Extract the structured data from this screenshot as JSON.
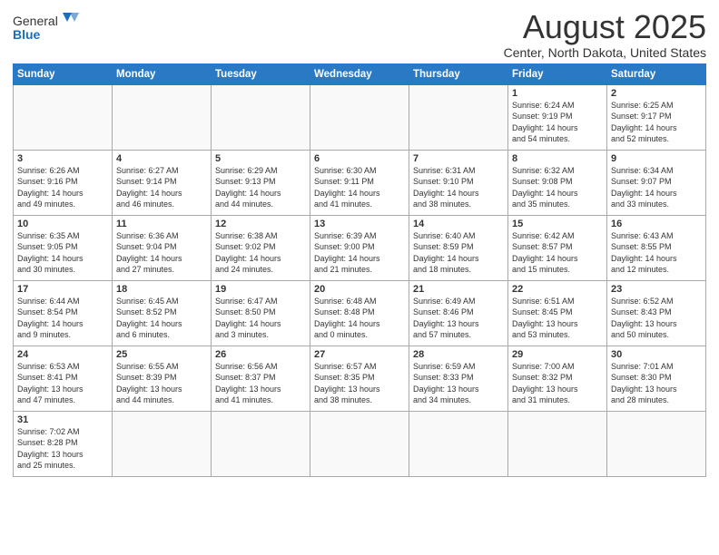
{
  "header": {
    "logo_general": "General",
    "logo_blue": "Blue",
    "title": "August 2025",
    "subtitle": "Center, North Dakota, United States"
  },
  "weekdays": [
    "Sunday",
    "Monday",
    "Tuesday",
    "Wednesday",
    "Thursday",
    "Friday",
    "Saturday"
  ],
  "weeks": [
    [
      {
        "day": "",
        "info": ""
      },
      {
        "day": "",
        "info": ""
      },
      {
        "day": "",
        "info": ""
      },
      {
        "day": "",
        "info": ""
      },
      {
        "day": "",
        "info": ""
      },
      {
        "day": "1",
        "info": "Sunrise: 6:24 AM\nSunset: 9:19 PM\nDaylight: 14 hours\nand 54 minutes."
      },
      {
        "day": "2",
        "info": "Sunrise: 6:25 AM\nSunset: 9:17 PM\nDaylight: 14 hours\nand 52 minutes."
      }
    ],
    [
      {
        "day": "3",
        "info": "Sunrise: 6:26 AM\nSunset: 9:16 PM\nDaylight: 14 hours\nand 49 minutes."
      },
      {
        "day": "4",
        "info": "Sunrise: 6:27 AM\nSunset: 9:14 PM\nDaylight: 14 hours\nand 46 minutes."
      },
      {
        "day": "5",
        "info": "Sunrise: 6:29 AM\nSunset: 9:13 PM\nDaylight: 14 hours\nand 44 minutes."
      },
      {
        "day": "6",
        "info": "Sunrise: 6:30 AM\nSunset: 9:11 PM\nDaylight: 14 hours\nand 41 minutes."
      },
      {
        "day": "7",
        "info": "Sunrise: 6:31 AM\nSunset: 9:10 PM\nDaylight: 14 hours\nand 38 minutes."
      },
      {
        "day": "8",
        "info": "Sunrise: 6:32 AM\nSunset: 9:08 PM\nDaylight: 14 hours\nand 35 minutes."
      },
      {
        "day": "9",
        "info": "Sunrise: 6:34 AM\nSunset: 9:07 PM\nDaylight: 14 hours\nand 33 minutes."
      }
    ],
    [
      {
        "day": "10",
        "info": "Sunrise: 6:35 AM\nSunset: 9:05 PM\nDaylight: 14 hours\nand 30 minutes."
      },
      {
        "day": "11",
        "info": "Sunrise: 6:36 AM\nSunset: 9:04 PM\nDaylight: 14 hours\nand 27 minutes."
      },
      {
        "day": "12",
        "info": "Sunrise: 6:38 AM\nSunset: 9:02 PM\nDaylight: 14 hours\nand 24 minutes."
      },
      {
        "day": "13",
        "info": "Sunrise: 6:39 AM\nSunset: 9:00 PM\nDaylight: 14 hours\nand 21 minutes."
      },
      {
        "day": "14",
        "info": "Sunrise: 6:40 AM\nSunset: 8:59 PM\nDaylight: 14 hours\nand 18 minutes."
      },
      {
        "day": "15",
        "info": "Sunrise: 6:42 AM\nSunset: 8:57 PM\nDaylight: 14 hours\nand 15 minutes."
      },
      {
        "day": "16",
        "info": "Sunrise: 6:43 AM\nSunset: 8:55 PM\nDaylight: 14 hours\nand 12 minutes."
      }
    ],
    [
      {
        "day": "17",
        "info": "Sunrise: 6:44 AM\nSunset: 8:54 PM\nDaylight: 14 hours\nand 9 minutes."
      },
      {
        "day": "18",
        "info": "Sunrise: 6:45 AM\nSunset: 8:52 PM\nDaylight: 14 hours\nand 6 minutes."
      },
      {
        "day": "19",
        "info": "Sunrise: 6:47 AM\nSunset: 8:50 PM\nDaylight: 14 hours\nand 3 minutes."
      },
      {
        "day": "20",
        "info": "Sunrise: 6:48 AM\nSunset: 8:48 PM\nDaylight: 14 hours\nand 0 minutes."
      },
      {
        "day": "21",
        "info": "Sunrise: 6:49 AM\nSunset: 8:46 PM\nDaylight: 13 hours\nand 57 minutes."
      },
      {
        "day": "22",
        "info": "Sunrise: 6:51 AM\nSunset: 8:45 PM\nDaylight: 13 hours\nand 53 minutes."
      },
      {
        "day": "23",
        "info": "Sunrise: 6:52 AM\nSunset: 8:43 PM\nDaylight: 13 hours\nand 50 minutes."
      }
    ],
    [
      {
        "day": "24",
        "info": "Sunrise: 6:53 AM\nSunset: 8:41 PM\nDaylight: 13 hours\nand 47 minutes."
      },
      {
        "day": "25",
        "info": "Sunrise: 6:55 AM\nSunset: 8:39 PM\nDaylight: 13 hours\nand 44 minutes."
      },
      {
        "day": "26",
        "info": "Sunrise: 6:56 AM\nSunset: 8:37 PM\nDaylight: 13 hours\nand 41 minutes."
      },
      {
        "day": "27",
        "info": "Sunrise: 6:57 AM\nSunset: 8:35 PM\nDaylight: 13 hours\nand 38 minutes."
      },
      {
        "day": "28",
        "info": "Sunrise: 6:59 AM\nSunset: 8:33 PM\nDaylight: 13 hours\nand 34 minutes."
      },
      {
        "day": "29",
        "info": "Sunrise: 7:00 AM\nSunset: 8:32 PM\nDaylight: 13 hours\nand 31 minutes."
      },
      {
        "day": "30",
        "info": "Sunrise: 7:01 AM\nSunset: 8:30 PM\nDaylight: 13 hours\nand 28 minutes."
      }
    ],
    [
      {
        "day": "31",
        "info": "Sunrise: 7:02 AM\nSunset: 8:28 PM\nDaylight: 13 hours\nand 25 minutes."
      },
      {
        "day": "",
        "info": ""
      },
      {
        "day": "",
        "info": ""
      },
      {
        "day": "",
        "info": ""
      },
      {
        "day": "",
        "info": ""
      },
      {
        "day": "",
        "info": ""
      },
      {
        "day": "",
        "info": ""
      }
    ]
  ]
}
